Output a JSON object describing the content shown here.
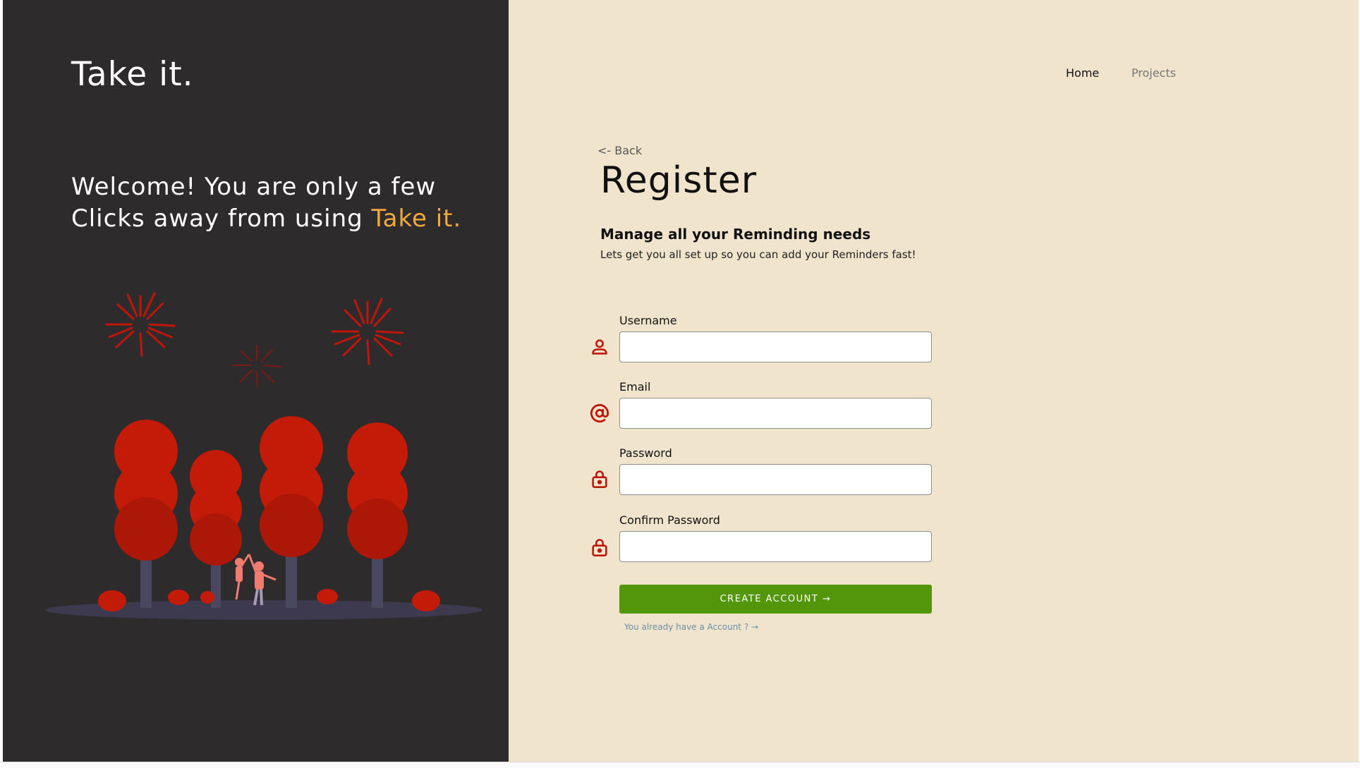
{
  "brand": {
    "name": "Take it."
  },
  "welcome": {
    "text": "Welcome! You are only a few Clicks away from using ",
    "accent": "Take it."
  },
  "nav": {
    "home": "Home",
    "projects": "Projects"
  },
  "form": {
    "back": "<- Back",
    "title": "Register",
    "subtitle": "Manage all your Reminding needs",
    "description": "Lets get you all set up so you can add your Reminders fast!",
    "fields": [
      {
        "label": "Username",
        "icon": "user-icon",
        "value": ""
      },
      {
        "label": "Email",
        "icon": "at-icon",
        "value": ""
      },
      {
        "label": "Password",
        "icon": "lock-icon",
        "value": ""
      },
      {
        "label": "Confirm Password",
        "icon": "lock-icon",
        "value": ""
      }
    ],
    "submit": "CREATE ACCOUNT →",
    "login_link": "You already have a Account ? →"
  },
  "colors": {
    "left_bg": "#2e2b2d",
    "right_bg": "#f1e4cd",
    "accent": "#f2a93b",
    "icon": "#c0150a",
    "button": "#54960a",
    "link": "#6b8fa8"
  }
}
